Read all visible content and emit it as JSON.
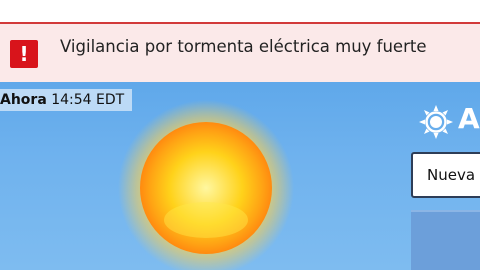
{
  "alert": {
    "icon": "exclamation-icon",
    "icon_glyph": "!",
    "text": "Vigilancia por tormenta eléctrica muy fuerte",
    "color": "#d8141b"
  },
  "current": {
    "now_label": "Ahora",
    "time": "14:54 EDT",
    "condition_icon": "sun-icon"
  },
  "header": {
    "title": "A",
    "icon": "sun-outline-icon"
  },
  "location": {
    "value": "Nueva"
  }
}
